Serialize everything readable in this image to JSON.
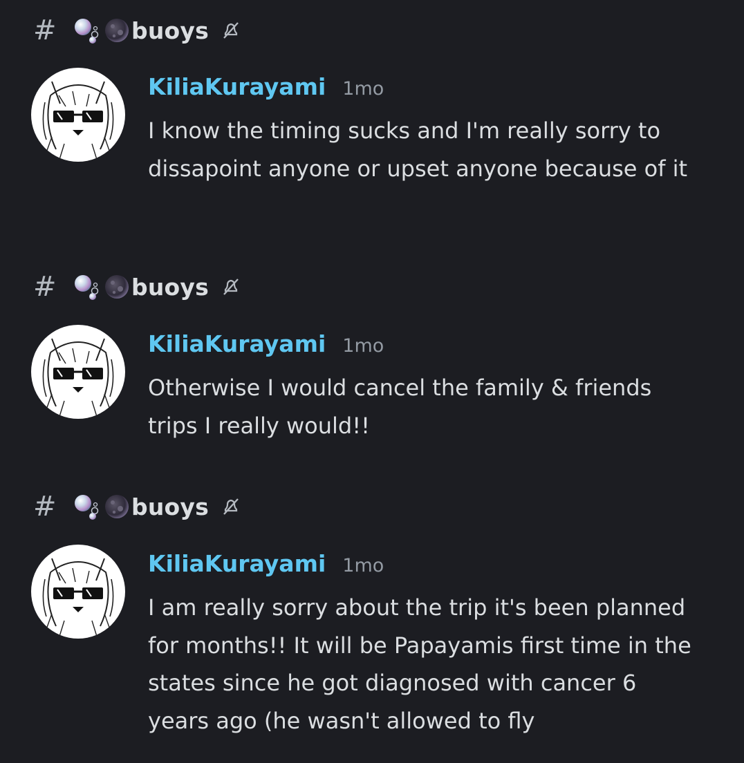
{
  "channel": {
    "hash_symbol": "#",
    "name": "buoys",
    "emoji_icons": [
      "bubbles-icon",
      "full-moon-icon"
    ],
    "mute_icon": "bell-slash-icon"
  },
  "messages": [
    {
      "channel_name": "buoys",
      "username": "KiliaKurayami",
      "timestamp": "1mo",
      "text": "I know the timing sucks and I'm really sorry to dissapoint anyone or upset anyone because of it"
    },
    {
      "channel_name": "buoys",
      "username": "KiliaKurayami",
      "timestamp": "1mo",
      "text": "Otherwise I would cancel the family & friends trips I really would!!"
    },
    {
      "channel_name": "buoys",
      "username": "KiliaKurayami",
      "timestamp": "1mo",
      "text": "I am really sorry about the trip it's been planned for months!! It will be Papayamis first time in the states since he got diagnosed with cancer 6 years ago (he wasn't allowed to fly"
    }
  ],
  "colors": {
    "background": "#1c1d22",
    "username": "#5fc7f1",
    "text": "#dbdee1",
    "muted": "#949ba4"
  }
}
